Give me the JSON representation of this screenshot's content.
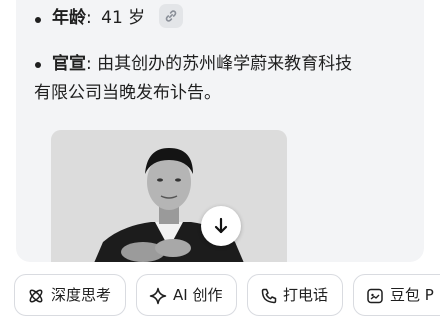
{
  "answer": {
    "age": {
      "key": "年龄",
      "sep": ":",
      "value": "41 岁",
      "link_icon": "link-icon"
    },
    "announcement": {
      "key": "官宣",
      "sep": ":",
      "line1": "由其创办的苏州峰学蔚来教育科技",
      "line2": "有限公司当晚发布讣告。"
    },
    "photo": {
      "alt": "grayscale portrait photo",
      "download_icon": "download-arrow-icon"
    }
  },
  "actions": [
    {
      "label": "深度思考",
      "icon": "atom-icon"
    },
    {
      "label": "AI 创作",
      "icon": "sparkle-icon"
    },
    {
      "label": "打电话",
      "icon": "phone-icon"
    },
    {
      "label": "豆包 P",
      "icon": "doubao-icon"
    }
  ],
  "colors": {
    "bubble_bg": "#f3f4f6",
    "text": "#1f1f1f",
    "chip_border": "#d9dbe0"
  }
}
